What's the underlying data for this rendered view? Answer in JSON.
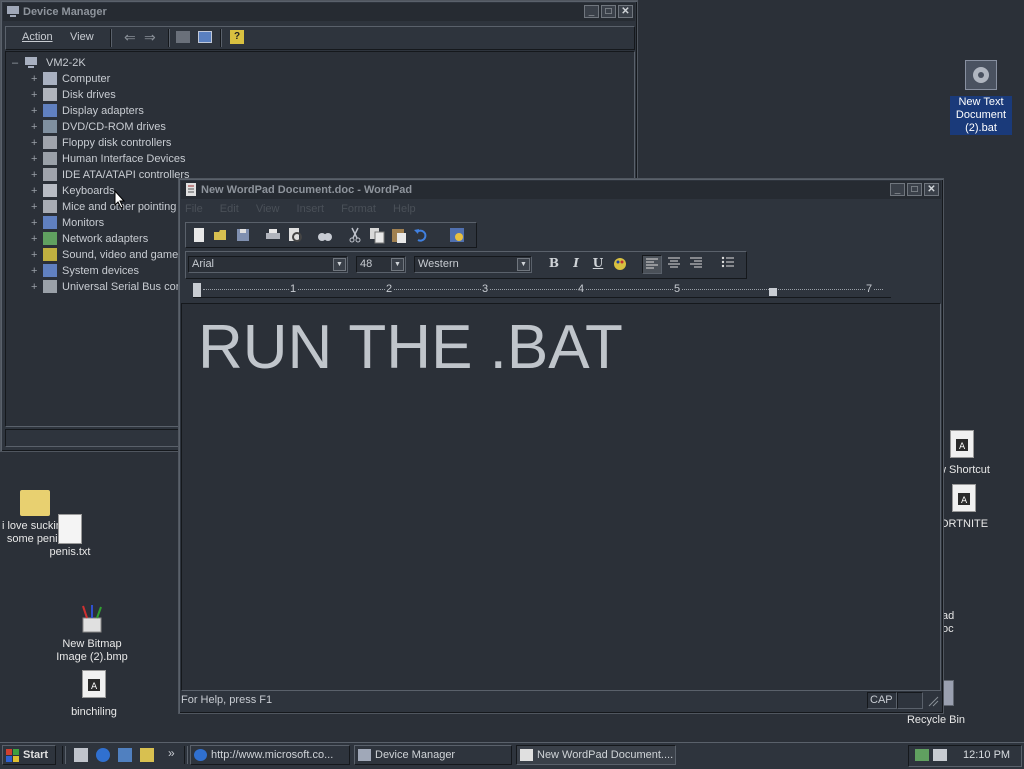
{
  "device_manager": {
    "title": "Device Manager",
    "menu": [
      "Action",
      "View"
    ],
    "root": "VM2-2K",
    "items": [
      "Computer",
      "Disk drives",
      "Display adapters",
      "DVD/CD-ROM drives",
      "Floppy disk controllers",
      "Human Interface Devices",
      "IDE ATA/ATAPI controllers",
      "Keyboards",
      "Mice and other pointing",
      "Monitors",
      "Network adapters",
      "Sound, video and game",
      "System devices",
      "Universal Serial Bus cor"
    ]
  },
  "wordpad": {
    "title": "New WordPad Document.doc - WordPad",
    "menu": [
      "File",
      "Edit",
      "View",
      "Insert",
      "Format",
      "Help"
    ],
    "font": "Arial",
    "size": "48",
    "script": "Western",
    "ruler": [
      "1",
      "2",
      "3",
      "4",
      "5",
      "7"
    ],
    "content": "RUN THE .BAT",
    "status": "For Help, press F1",
    "cap": "CAP"
  },
  "desktop": {
    "icons": {
      "bat_doc": "New Text Document (2).bat",
      "shortcut": "w Shortcut",
      "fortnite": "ORTNITE",
      "folder": "i love sucking some penis",
      "txt": "penis.txt",
      "bitmap": "New Bitmap Image (2).bmp",
      "binchiling": "binchiling",
      "ad": "ad",
      "oc": "oc",
      "recycle": "Recycle Bin"
    }
  },
  "taskbar": {
    "start": "Start",
    "chevron": "»",
    "tasks": [
      "http://www.microsoft.co...",
      "Device Manager",
      "New WordPad Document...."
    ],
    "clock": "12:10 PM"
  }
}
